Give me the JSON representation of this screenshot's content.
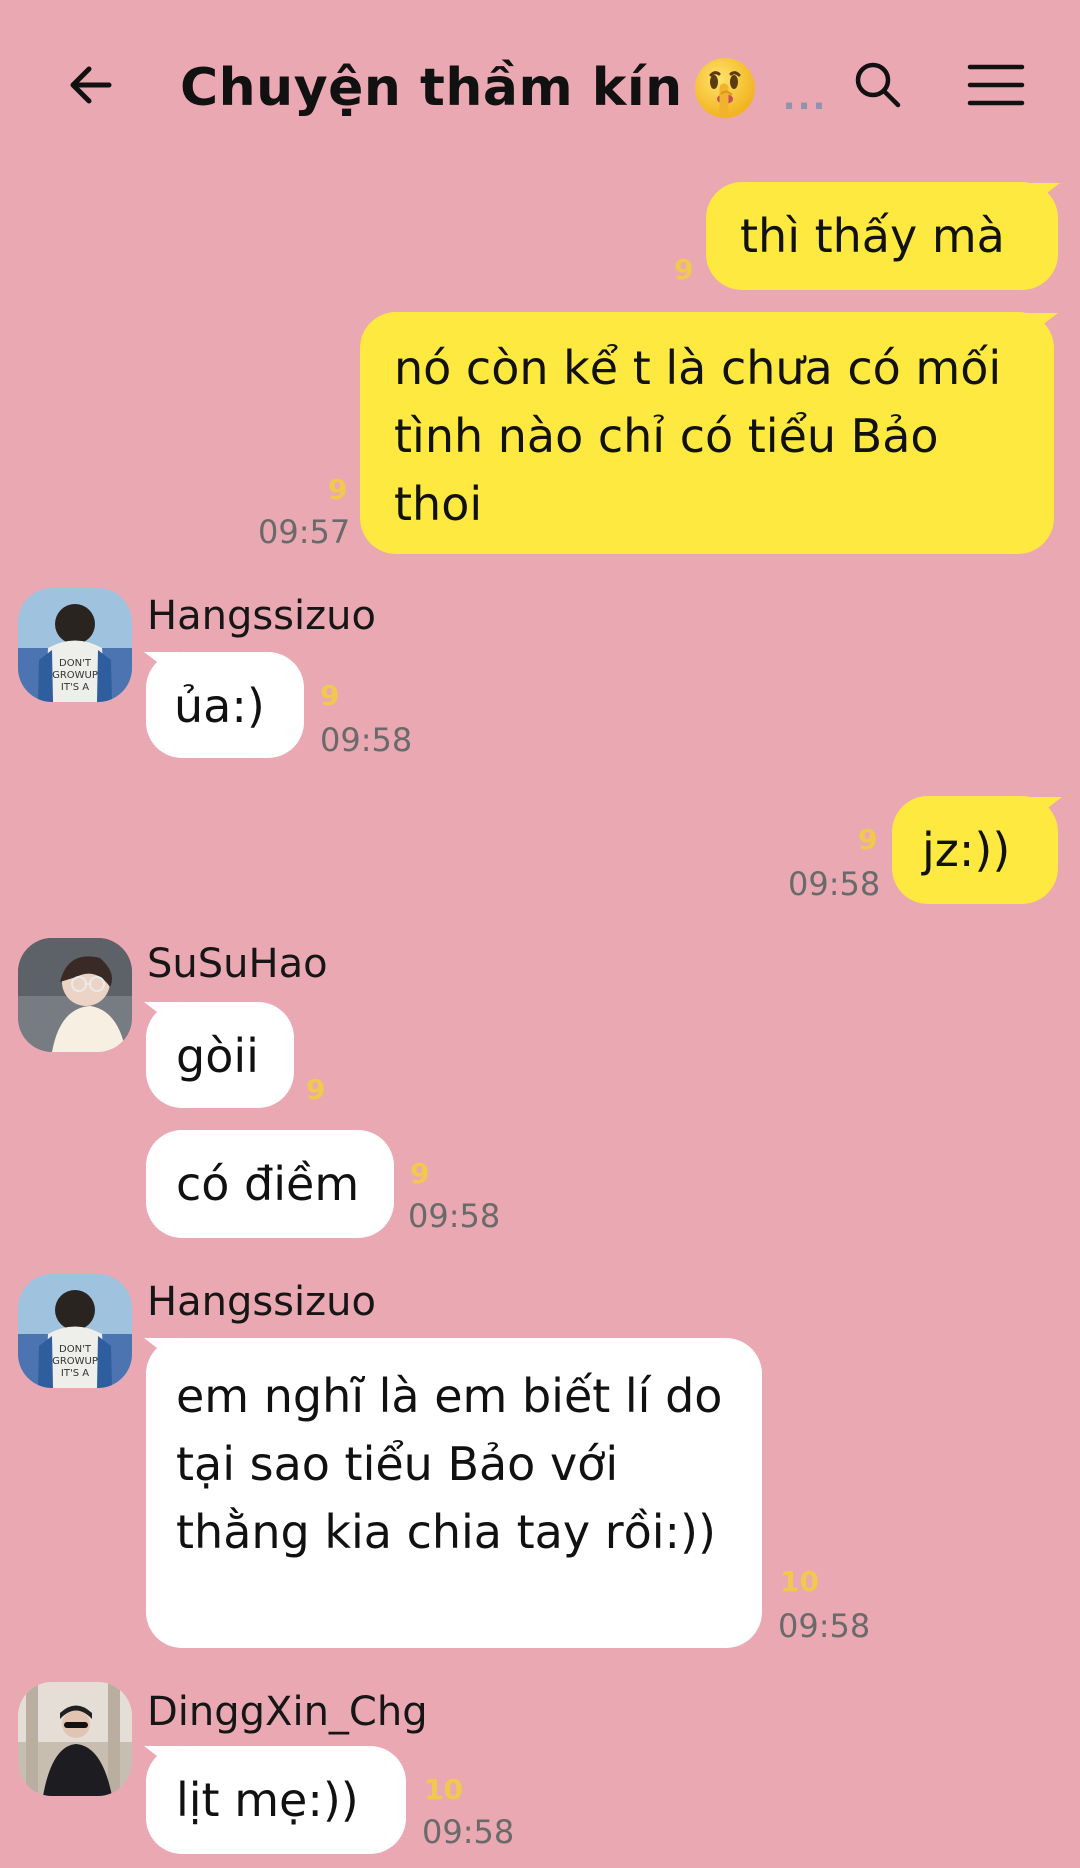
{
  "header": {
    "title": "Chuyện thầm kín",
    "title_emoji_name": "shushing-face-emoji",
    "more_indicator": "..."
  },
  "messages": [
    {
      "id": "m1",
      "direction": "outgoing",
      "text": "thì thấy mà",
      "count": "9",
      "time": ""
    },
    {
      "id": "m2",
      "direction": "outgoing",
      "text": "nó còn kể t là chưa có mối tình nào chỉ có tiểu Bảo thoi",
      "count": "9",
      "time": "09:57"
    },
    {
      "id": "m3",
      "direction": "incoming",
      "sender": "Hangssizuo",
      "text": "ủa:)",
      "count": "9",
      "time": "09:58"
    },
    {
      "id": "m4",
      "direction": "outgoing",
      "text": "jz:))",
      "count": "9",
      "time": "09:58"
    },
    {
      "id": "m5",
      "direction": "incoming",
      "sender": "SuSuHao",
      "text": "gòii",
      "count": "9",
      "time": ""
    },
    {
      "id": "m6",
      "direction": "incoming",
      "sender": "",
      "text": "có điềm",
      "count": "9",
      "time": "09:58"
    },
    {
      "id": "m7",
      "direction": "incoming",
      "sender": "Hangssizuo",
      "text": "em nghĩ là em biết lí do tại sao tiểu Bảo với thằng kia chia tay rồi:))",
      "count": "10",
      "time": "09:58"
    },
    {
      "id": "m8",
      "direction": "incoming",
      "sender": "DinggXin_Chg",
      "text": "lịt mẹ:))",
      "count": "10",
      "time": "09:58"
    }
  ],
  "colors": {
    "background": "#eaa8b2",
    "outgoing_bubble": "#fde93f",
    "incoming_bubble": "#ffffff",
    "unread_count": "#f0c94d",
    "timestamp": "#6a6a6a",
    "more_indicator": "#8f93ab"
  },
  "icons": {
    "back": "arrow-left-icon",
    "search": "search-icon",
    "menu": "hamburger-menu-icon"
  }
}
